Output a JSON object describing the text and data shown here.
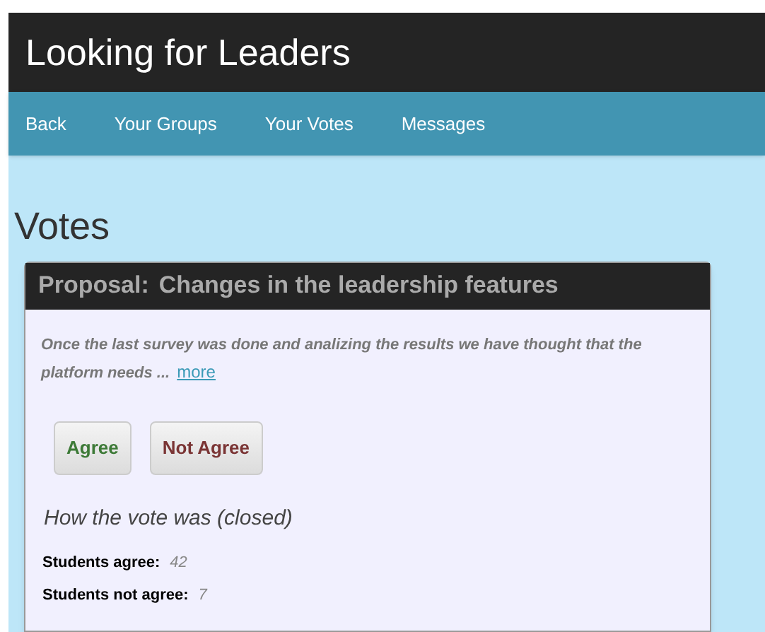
{
  "app_title": "Looking for Leaders",
  "nav": [
    "Back",
    "Your Groups",
    "Your Votes",
    "Messages"
  ],
  "page_title": "Votes",
  "proposal": {
    "label": "Proposal:",
    "title": "Changes in the leadership features",
    "summary": "Once the last survey was done and analizing the results we have thought that the platform needs ...",
    "more_link": "more",
    "buttons": [
      {
        "label": "Agree",
        "kind": "agree"
      },
      {
        "label": "Not Agree",
        "kind": "disagree"
      }
    ],
    "result_heading": "How the vote was (closed)",
    "results": [
      {
        "label": "Students agree:",
        "value": "42"
      },
      {
        "label": "Students not agree:",
        "value": "7"
      }
    ]
  }
}
